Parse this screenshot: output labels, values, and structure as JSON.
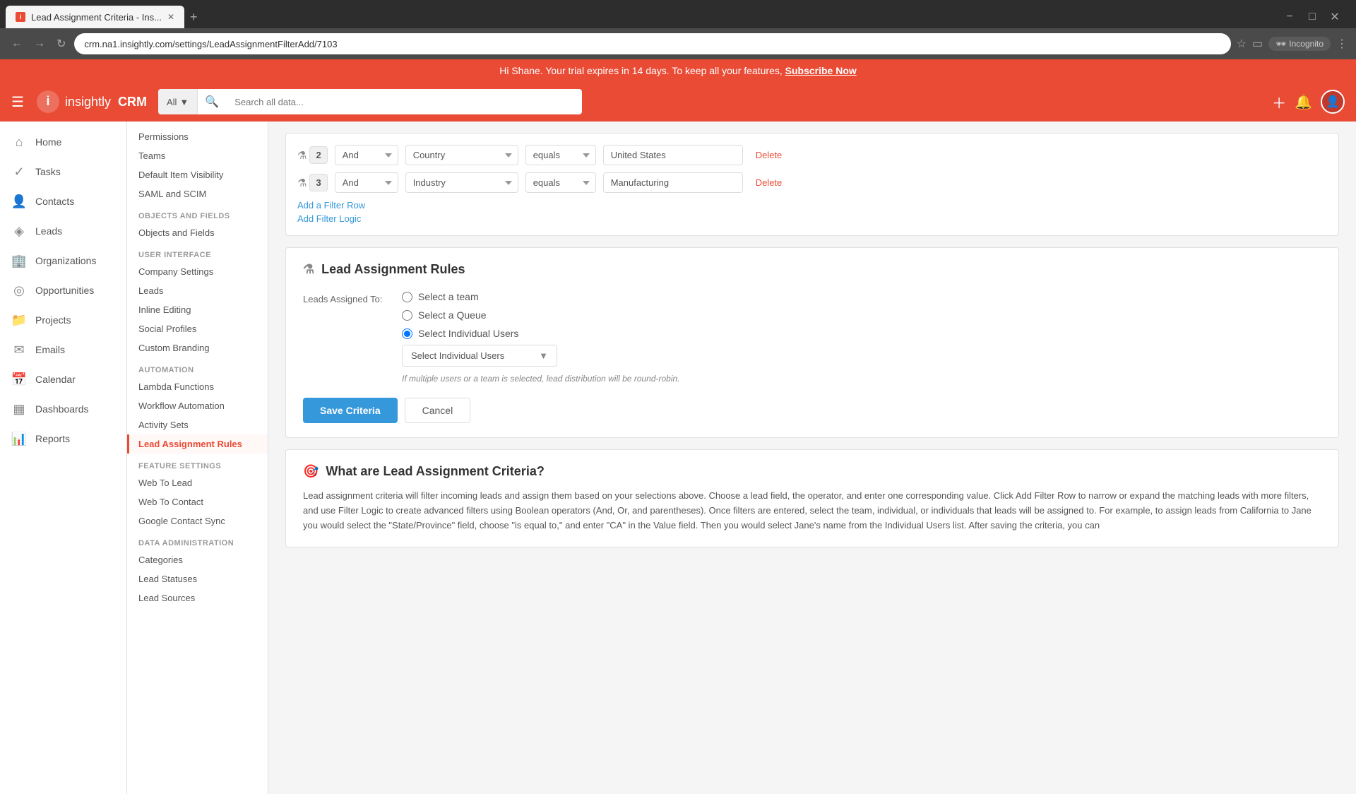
{
  "browser": {
    "tab_title": "Lead Assignment Criteria - Ins...",
    "url": "crm.na1.insightly.com/settings/LeadAssignmentFilterAdd/7103",
    "new_tab_label": "+",
    "incognito_label": "Incognito",
    "window_controls": [
      "−",
      "□",
      "×"
    ]
  },
  "trial_banner": {
    "text": "Hi Shane. Your trial expires in 14 days. To keep all your features,",
    "link_text": "Subscribe Now"
  },
  "header": {
    "logo_text": "insightly",
    "crm_text": "CRM",
    "search_all_label": "All",
    "search_placeholder": "Search all data..."
  },
  "sidebar": {
    "items": [
      {
        "id": "home",
        "label": "Home",
        "icon": "⌂"
      },
      {
        "id": "tasks",
        "label": "Tasks",
        "icon": "✓"
      },
      {
        "id": "contacts",
        "label": "Contacts",
        "icon": "👤"
      },
      {
        "id": "leads",
        "label": "Leads",
        "icon": "◈"
      },
      {
        "id": "organizations",
        "label": "Organizations",
        "icon": "🏢"
      },
      {
        "id": "opportunities",
        "label": "Opportunities",
        "icon": "◎"
      },
      {
        "id": "projects",
        "label": "Projects",
        "icon": "📁"
      },
      {
        "id": "emails",
        "label": "Emails",
        "icon": "✉"
      },
      {
        "id": "calendar",
        "label": "Calendar",
        "icon": "📅"
      },
      {
        "id": "dashboards",
        "label": "Dashboards",
        "icon": "▦"
      },
      {
        "id": "reports",
        "label": "Reports",
        "icon": "📊"
      }
    ]
  },
  "settings_nav": {
    "sections": [
      {
        "header": "",
        "items": [
          {
            "label": "Permissions",
            "active": false
          },
          {
            "label": "Teams",
            "active": false
          },
          {
            "label": "Default Item Visibility",
            "active": false
          },
          {
            "label": "SAML and SCIM",
            "active": false
          }
        ]
      },
      {
        "header": "Objects and Fields",
        "items": [
          {
            "label": "Objects and Fields",
            "active": false
          }
        ]
      },
      {
        "header": "User Interface",
        "items": [
          {
            "label": "Company Settings",
            "active": false
          },
          {
            "label": "Leads",
            "active": false
          },
          {
            "label": "Inline Editing",
            "active": false
          },
          {
            "label": "Social Profiles",
            "active": false
          },
          {
            "label": "Custom Branding",
            "active": false
          }
        ]
      },
      {
        "header": "Automation",
        "items": [
          {
            "label": "Lambda Functions",
            "active": false
          },
          {
            "label": "Workflow Automation",
            "active": false
          },
          {
            "label": "Activity Sets",
            "active": false
          },
          {
            "label": "Lead Assignment Rules",
            "active": true
          }
        ]
      },
      {
        "header": "Feature Settings",
        "items": [
          {
            "label": "Web To Lead",
            "active": false
          },
          {
            "label": "Web To Contact",
            "active": false
          },
          {
            "label": "Google Contact Sync",
            "active": false
          }
        ]
      },
      {
        "header": "Data Administration",
        "items": [
          {
            "label": "Categories",
            "active": false
          },
          {
            "label": "Lead Statuses",
            "active": false
          },
          {
            "label": "Lead Sources",
            "active": false
          }
        ]
      }
    ]
  },
  "filters": [
    {
      "num": "2",
      "logic": "And",
      "field": "Country",
      "operator": "equals",
      "value": "United States"
    },
    {
      "num": "3",
      "logic": "And",
      "field": "Industry",
      "operator": "equals",
      "value": "Manufacturing"
    }
  ],
  "filter_actions": {
    "add_row": "Add a Filter Row",
    "add_logic": "Add Filter Logic"
  },
  "assignment_rules": {
    "section_title": "Lead Assignment Rules",
    "form_label": "Leads Assigned To:",
    "options": [
      {
        "id": "team",
        "label": "Select a team",
        "checked": false
      },
      {
        "id": "queue",
        "label": "Select a Queue",
        "checked": false
      },
      {
        "id": "individual",
        "label": "Select Individual Users",
        "checked": true
      }
    ],
    "dropdown_label": "Select Individual Users",
    "hint_text": "If multiple users or a team is selected, lead distribution will be round-robin.",
    "save_label": "Save Criteria",
    "cancel_label": "Cancel"
  },
  "info_section": {
    "title": "What are Lead Assignment Criteria?",
    "text": "Lead assignment criteria will filter incoming leads and assign them based on your selections above. Choose a lead field, the operator, and enter one corresponding value. Click Add Filter Row to narrow or expand the matching leads with more filters, and use Filter Logic to create advanced filters using Boolean operators (And, Or, and parentheses). Once filters are entered, select the team, individual, or individuals that leads will be assigned to. For example, to assign leads from California to Jane you would select the \"State/Province\" field, choose \"is equal to,\" and enter \"CA\" in the Value field. Then you would select Jane's name from the Individual Users list. After saving the criteria, you can"
  },
  "filter_badge_icon": "⚗",
  "info_badge_icon": "🎯"
}
